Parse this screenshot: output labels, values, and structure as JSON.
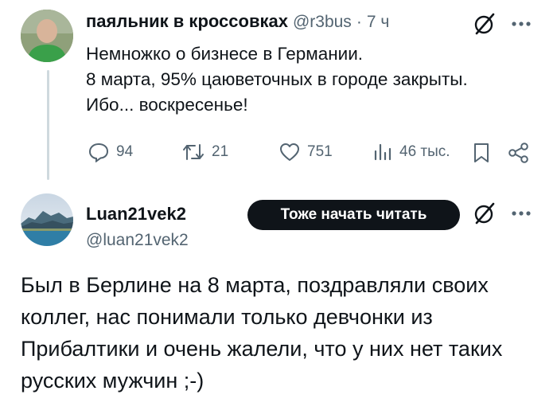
{
  "tweet": {
    "author_name": "паяльник в кроссовках",
    "handle": "@r3bus",
    "separator": "·",
    "time": "7 ч",
    "text_lines": [
      "Немножко о бизнесе в Германии.",
      "8 марта, 95% цаюветочных в городе закрыты.",
      "Ибо... воскресенье!"
    ],
    "metrics": {
      "replies": "94",
      "reposts": "21",
      "likes": "751",
      "views": "46 тыс."
    },
    "icons": [
      "grok-icon",
      "more-icon",
      "reply-icon",
      "repost-icon",
      "like-icon",
      "views-icon",
      "bookmark-icon",
      "share-icon"
    ]
  },
  "reply": {
    "author_name": "Luan21vek2",
    "handle": "@luan21vek2",
    "follow_label": "Тоже начать читать",
    "text": "Был в Берлине на 8 марта, поздравляли своих коллег, нас понимали только девчонки из Прибалтики и очень жалели, что у них нет таких русских мужчин  ;-)"
  },
  "colors": {
    "text": "#0f1419",
    "secondary": "#536471",
    "thread_line": "#cfd9de",
    "button_bg": "#0f1419"
  }
}
